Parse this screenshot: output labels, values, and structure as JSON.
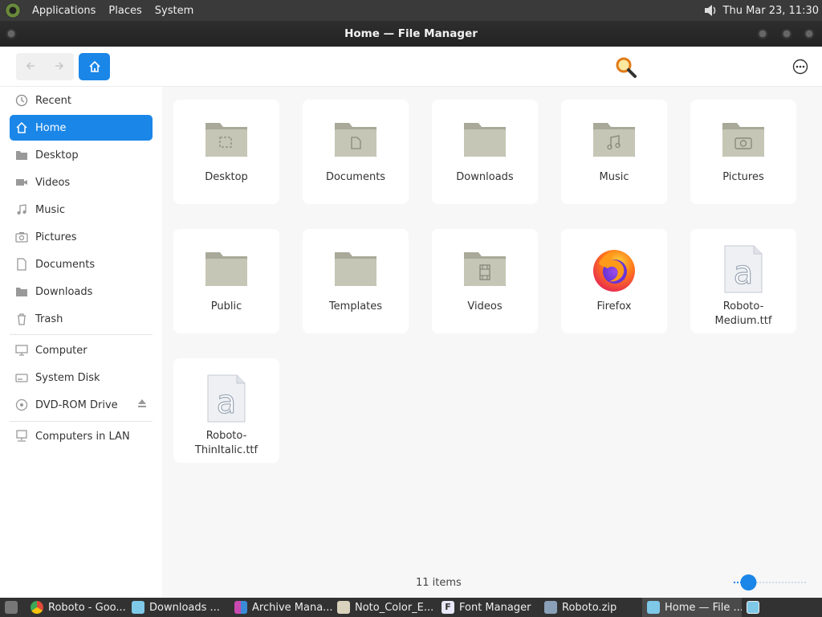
{
  "top_panel": {
    "menus": [
      "Applications",
      "Places",
      "System"
    ],
    "clock": "Thu Mar 23, 11:30",
    "icons": [
      "distro-logo-icon",
      "volume-icon"
    ]
  },
  "window": {
    "title": "Home — File Manager"
  },
  "toolbar": {
    "back_icon": "arrow-left-icon",
    "forward_icon": "arrow-right-icon",
    "home_icon": "home-icon",
    "search_icon": "search-icon",
    "more_icon": "more-options-icon"
  },
  "sidebar": {
    "places": [
      {
        "label": "Recent",
        "icon": "clock-icon"
      },
      {
        "label": "Home",
        "icon": "home-icon",
        "active": true
      },
      {
        "label": "Desktop",
        "icon": "folder-icon"
      },
      {
        "label": "Videos",
        "icon": "video-icon"
      },
      {
        "label": "Music",
        "icon": "music-icon"
      },
      {
        "label": "Pictures",
        "icon": "camera-icon"
      },
      {
        "label": "Documents",
        "icon": "document-icon"
      },
      {
        "label": "Downloads",
        "icon": "folder-icon"
      },
      {
        "label": "Trash",
        "icon": "trash-icon"
      }
    ],
    "devices": [
      {
        "label": "Computer",
        "icon": "computer-icon"
      },
      {
        "label": "System Disk",
        "icon": "disk-icon"
      },
      {
        "label": "DVD-ROM Drive",
        "icon": "dvd-icon"
      }
    ],
    "network": [
      {
        "label": "Computers in LAN",
        "icon": "network-icon"
      }
    ]
  },
  "files": [
    {
      "name": "Desktop",
      "type": "folder"
    },
    {
      "name": "Documents",
      "type": "folder"
    },
    {
      "name": "Downloads",
      "type": "folder"
    },
    {
      "name": "Music",
      "type": "folder"
    },
    {
      "name": "Pictures",
      "type": "folder"
    },
    {
      "name": "Public",
      "type": "folder"
    },
    {
      "name": "Templates",
      "type": "folder"
    },
    {
      "name": "Videos",
      "type": "folder"
    },
    {
      "name": "Firefox",
      "type": "app"
    },
    {
      "name": "Roboto-\nMedium.ttf",
      "type": "font"
    },
    {
      "name": "Roboto-\nThinItalic.ttf",
      "type": "font"
    }
  ],
  "status": {
    "item_count": "11 items",
    "zoom_level": 0.2
  },
  "taskbar": {
    "items": [
      {
        "label": "Roboto - Goo...",
        "color": "#e04a3a"
      },
      {
        "label": "Downloads ...",
        "color": "#7ec8e8"
      },
      {
        "label": "Archive Mana...",
        "color": "#c84ab0"
      },
      {
        "label": "Noto_Color_E...",
        "color": "#d9d2bd"
      },
      {
        "label": "Font Manager",
        "color": "#e8e8f8"
      },
      {
        "label": "Roboto.zip",
        "color": "#8aa0b8"
      },
      {
        "label": "Home — File ...",
        "color": "#7ec8e8",
        "active": true
      }
    ]
  },
  "colors": {
    "accent": "#1a86e8",
    "folder": "#bdbdaa"
  }
}
